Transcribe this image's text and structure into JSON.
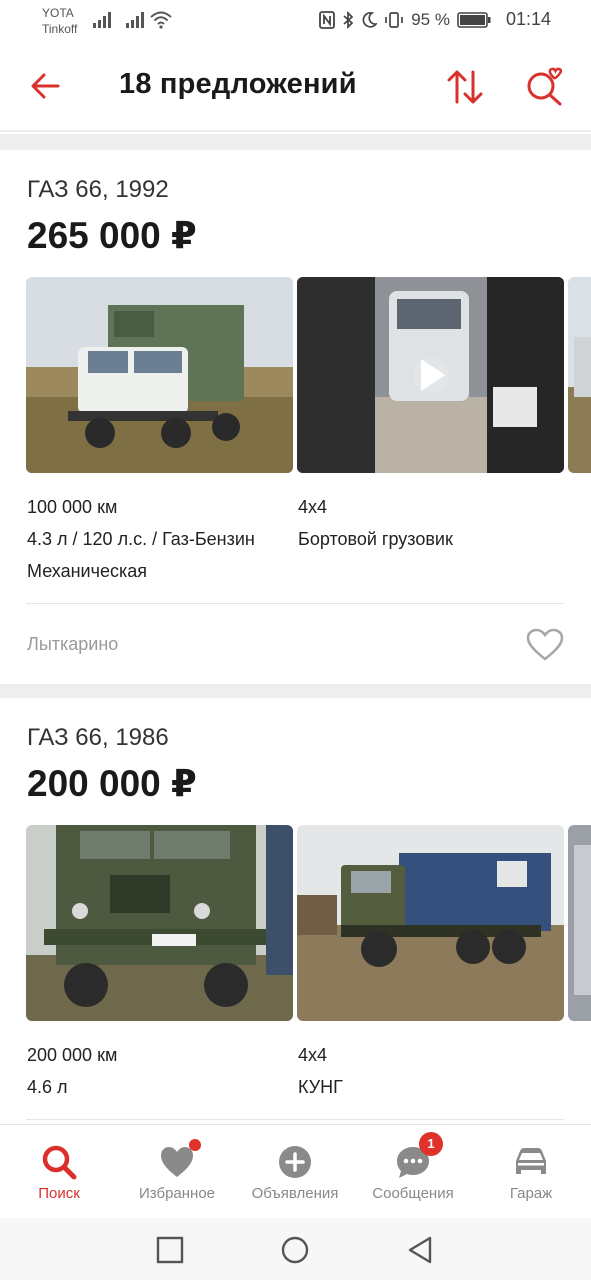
{
  "status_bar": {
    "carrier_1": "YOTA",
    "carrier_2": "Tinkoff",
    "battery_percent": "95 %",
    "time": "01:14",
    "icons": [
      "signal-icon",
      "wifi-icon",
      "nfc-icon",
      "bluetooth-icon",
      "moon-icon",
      "vibrate-icon",
      "battery-icon"
    ]
  },
  "header": {
    "title": "18 предложений",
    "accent_color": "#d9302c"
  },
  "listings": [
    {
      "title": "ГАЗ 66, 1992",
      "price": "265 000 ₽",
      "mileage": "100 000 км",
      "engine": "4.3 л / 120 л.с. / Газ-Бензин",
      "transmission": "Механическая",
      "drive": "4x4",
      "body": "Бортовой грузовик",
      "location": "Лыткарино",
      "photos": [
        "truck-photo",
        "video-thumbnail"
      ]
    },
    {
      "title": "ГАЗ 66, 1986",
      "price": "200 000 ₽",
      "mileage": "200 000 км",
      "engine": "4.6 л",
      "drive": "4x4",
      "body": "КУНГ",
      "photos": [
        "truck-photo",
        "truck-photo"
      ]
    }
  ],
  "bottom_nav": [
    {
      "label": "Поиск",
      "icon": "search-icon",
      "active": true
    },
    {
      "label": "Избранное",
      "icon": "heart-icon",
      "dot": true
    },
    {
      "label": "Объявления",
      "icon": "plus-circle-icon"
    },
    {
      "label": "Сообщения",
      "icon": "chat-icon",
      "badge": "1"
    },
    {
      "label": "Гараж",
      "icon": "car-icon"
    }
  ]
}
